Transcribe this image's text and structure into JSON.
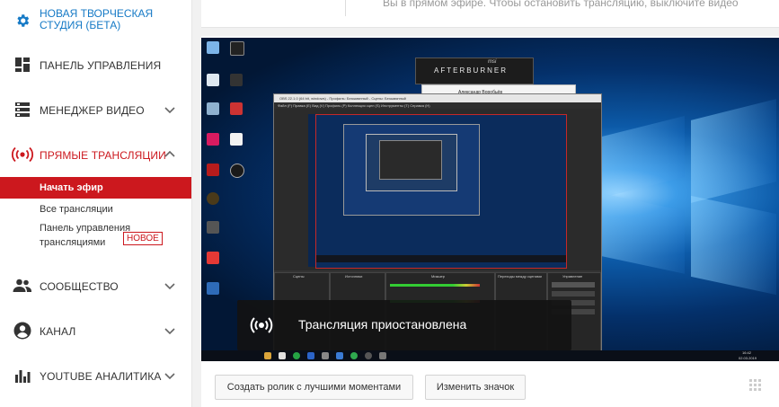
{
  "sidebar": {
    "studio_title_line1": "НОВАЯ ТВОРЧЕСКАЯ",
    "studio_title_line2": "СТУДИЯ (БЕТА)",
    "items": [
      {
        "label": "ПАНЕЛЬ УПРАВЛЕНИЯ",
        "icon": "dashboard-icon"
      },
      {
        "label": "МЕНЕДЖЕР ВИДЕО",
        "icon": "video-manager-icon"
      },
      {
        "label": "ПРЯМЫЕ ТРАНСЛЯЦИИ",
        "icon": "live-broadcast-icon"
      },
      {
        "label": "СООБЩЕСТВО",
        "icon": "community-icon"
      },
      {
        "label": "КАНАЛ",
        "icon": "channel-icon"
      },
      {
        "label": "YOUTUBE АНАЛИТИКА",
        "icon": "analytics-icon"
      }
    ],
    "live_subitems": {
      "start": "Начать эфир",
      "all": "Все трансляции",
      "panel_line1": "Панель управления",
      "panel_line2": "трансляциями",
      "new_badge": "НОВОЕ"
    }
  },
  "top_note": "Вы в прямом эфире. Чтобы остановить трансляцию, выключите видео",
  "player": {
    "paused_text": "Трансляция приостановлена",
    "embedded": {
      "afterburner": "AFTERBURNER",
      "msi": "msi",
      "obs_title": "OBS 22.1.0 (64 bit, windows) - Профиль: Безымянный - Сцены: Безымянный",
      "obs_menu": "Файл (F)   Правка (E)   Вид (V)   Профиль (P)   Коллекция сцен (S)   Инструменты (T)   Справка (H)",
      "window_title": "Александр Воробьёв",
      "docks": [
        "Сцены",
        "Источники",
        "Микшер",
        "Переходы между сценами",
        "Управление"
      ],
      "clock": "16:42",
      "date": "02.03.2019"
    }
  },
  "actions": {
    "highlights": "Создать ролик с лучшими моментами",
    "change_thumb": "Изменить значок"
  },
  "colors": {
    "accent_red": "#cc181e",
    "link_blue": "#167ac6",
    "background": "#f1f1f1"
  }
}
